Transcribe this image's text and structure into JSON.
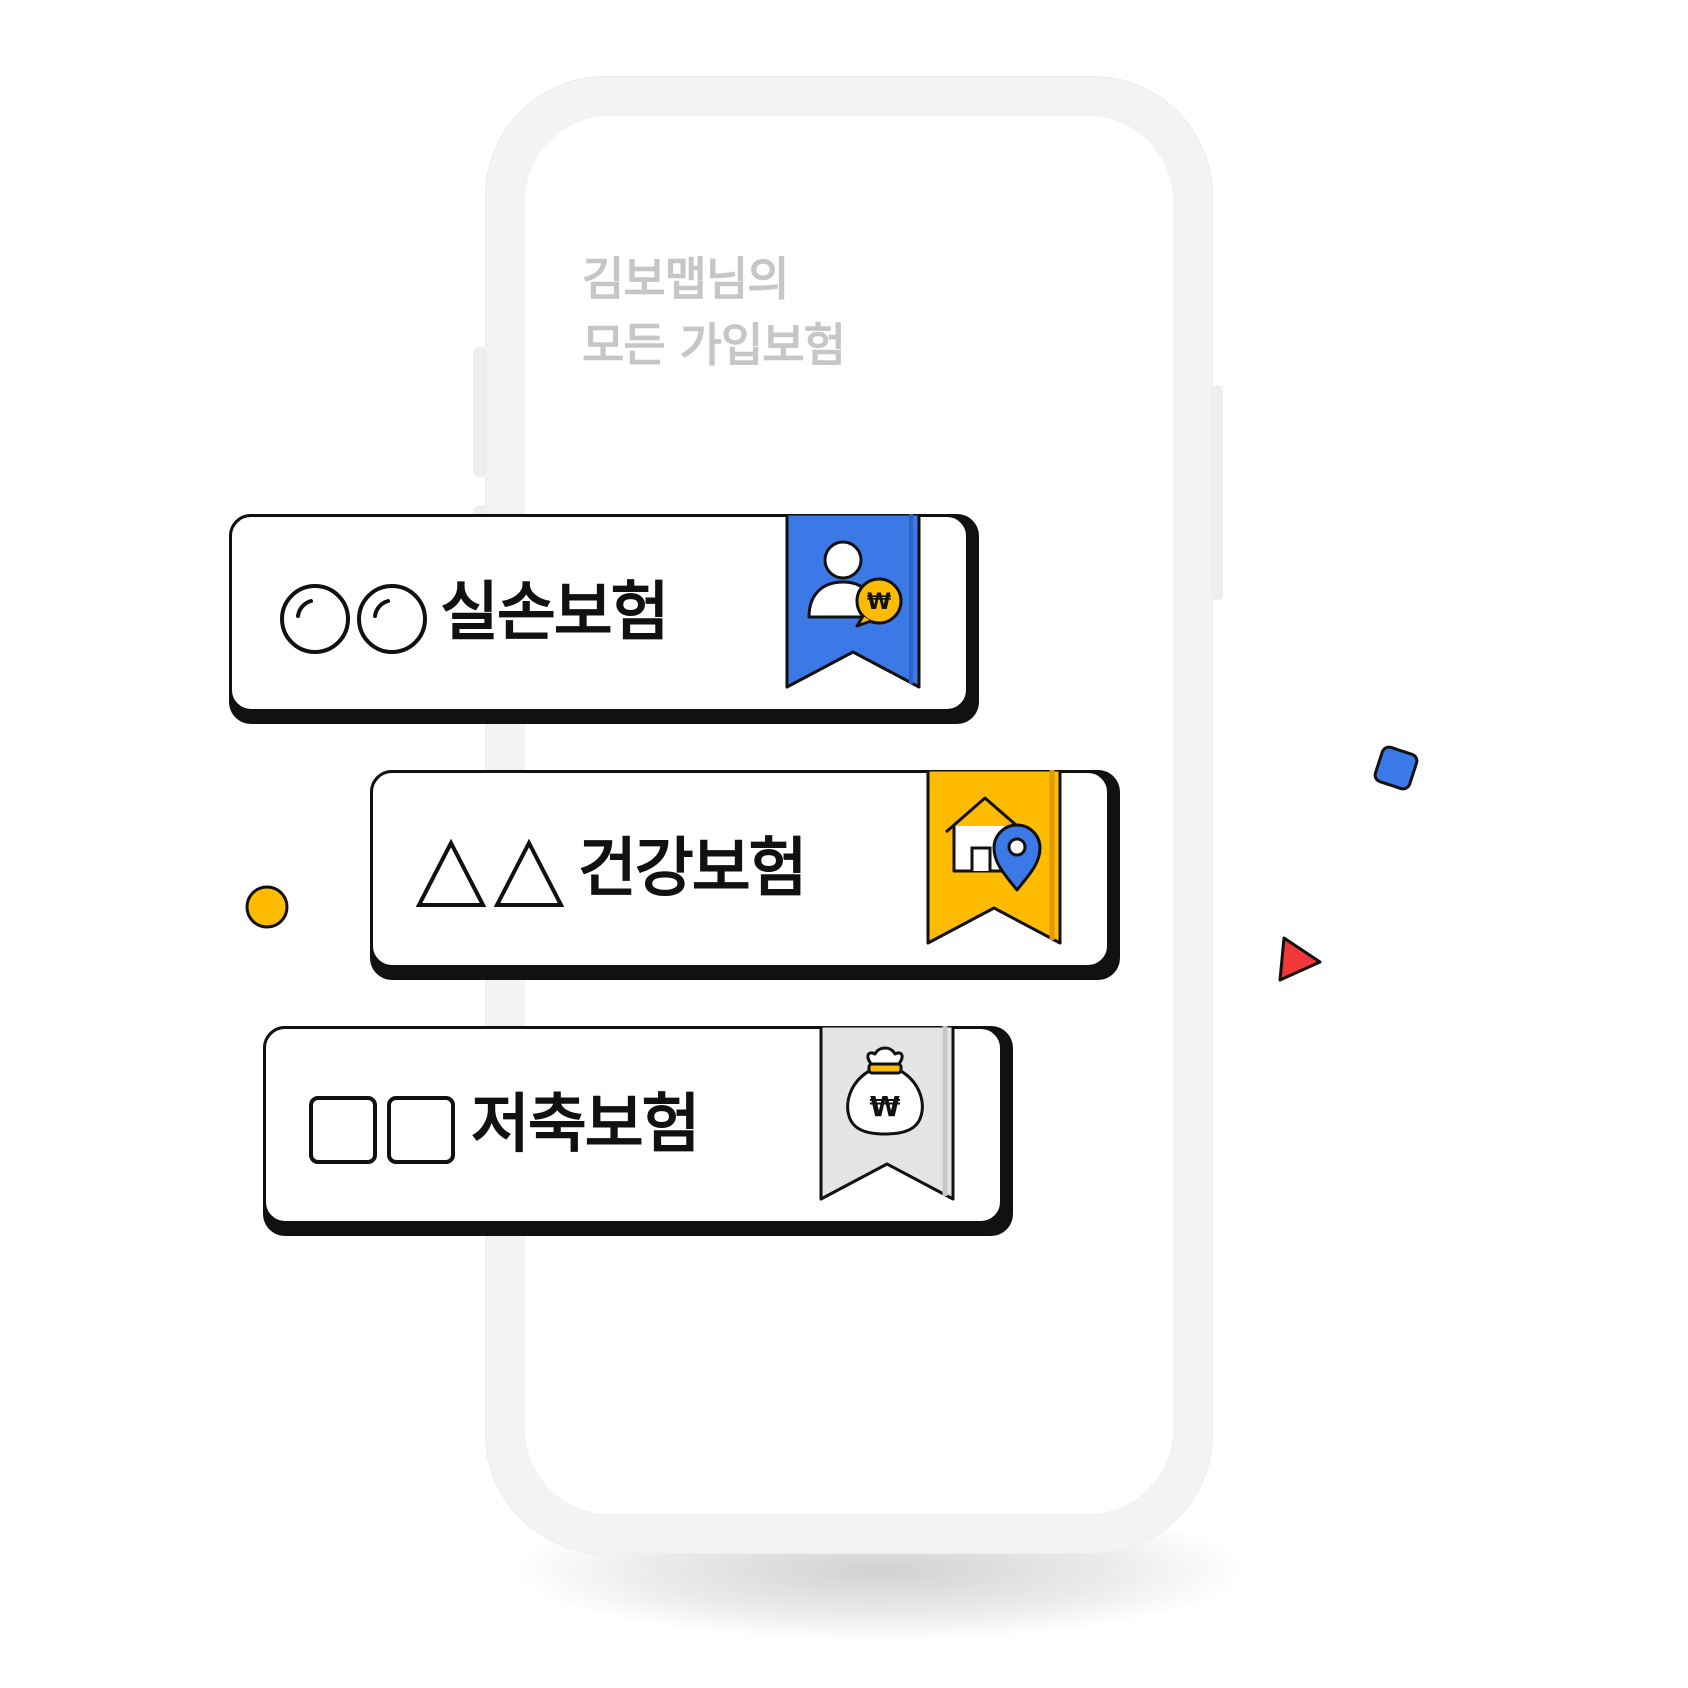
{
  "greeting": {
    "line1": "김보맵님의",
    "line2": "모든 가입보험"
  },
  "cards": [
    {
      "prefix_shape": "circle-pair",
      "label": "실손보험",
      "ribbon_color": "#3b7ae6",
      "ribbon_icon": "person-won-icon"
    },
    {
      "prefix_shape": "triangle-pair",
      "label": "건강보험",
      "ribbon_color": "#ffbb00",
      "ribbon_icon": "house-location-icon"
    },
    {
      "prefix_shape": "square-pair",
      "label": "저축보험",
      "ribbon_color": "#e4e4e4",
      "ribbon_icon": "money-bag-won-icon"
    }
  ],
  "colors": {
    "blue": "#3b7ae6",
    "yellow": "#ffbb00",
    "red": "#f0383a",
    "outline": "#111111",
    "greeting_text": "#c6c6c6"
  }
}
